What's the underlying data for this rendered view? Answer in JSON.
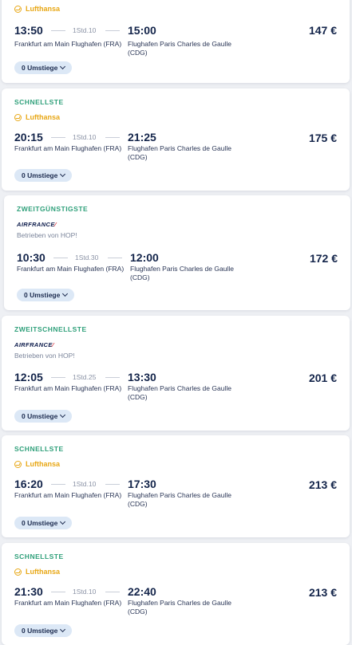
{
  "flights": [
    {
      "badge": "",
      "airline": "Lufthansa",
      "airline_logo": "lufthansa-logo",
      "operated_by": "",
      "departure_time": "13:50",
      "duration": "1Std.10",
      "arrival_time": "15:00",
      "departure_airport": "Frankfurt am Main Flughafen (FRA)",
      "arrival_airport": "Flughafen Paris Charles de Gaulle (CDG)",
      "price": "147 €",
      "stops_label": "0 Umstiege"
    },
    {
      "badge": "SCHNELLSTE",
      "airline": "Lufthansa",
      "airline_logo": "lufthansa-logo",
      "operated_by": "",
      "departure_time": "20:15",
      "duration": "1Std.10",
      "arrival_time": "21:25",
      "departure_airport": "Frankfurt am Main Flughafen (FRA)",
      "arrival_airport": "Flughafen Paris Charles de Gaulle (CDG)",
      "price": "175 €",
      "stops_label": "0 Umstiege"
    },
    {
      "badge": "ZWEITGÜNSTIGSTE",
      "airline": "AIRFRANCE",
      "airline_logo": "air-france-logo",
      "operated_by": "Betrieben von HOP!",
      "departure_time": "10:30",
      "duration": "1Std.30",
      "arrival_time": "12:00",
      "departure_airport": "Frankfurt am Main Flughafen (FRA)",
      "arrival_airport": "Flughafen Paris Charles de Gaulle (CDG)",
      "price": "172 €",
      "stops_label": "0 Umstiege"
    },
    {
      "badge": "ZWEITSCHNELLSTE",
      "airline": "AIRFRANCE",
      "airline_logo": "air-france-logo",
      "operated_by": "Betrieben von HOP!",
      "departure_time": "12:05",
      "duration": "1Std.25",
      "arrival_time": "13:30",
      "departure_airport": "Frankfurt am Main Flughafen (FRA)",
      "arrival_airport": "Flughafen Paris Charles de Gaulle (CDG)",
      "price": "201 €",
      "stops_label": "0 Umstiege"
    },
    {
      "badge": "SCHNELLSTE",
      "airline": "Lufthansa",
      "airline_logo": "lufthansa-logo",
      "operated_by": "",
      "departure_time": "16:20",
      "duration": "1Std.10",
      "arrival_time": "17:30",
      "departure_airport": "Frankfurt am Main Flughafen (FRA)",
      "arrival_airport": "Flughafen Paris Charles de Gaulle (CDG)",
      "price": "213 €",
      "stops_label": "0 Umstiege"
    },
    {
      "badge": "SCHNELLSTE",
      "airline": "Lufthansa",
      "airline_logo": "lufthansa-logo",
      "operated_by": "",
      "departure_time": "21:30",
      "duration": "1Std.10",
      "arrival_time": "22:40",
      "departure_airport": "Frankfurt am Main Flughafen (FRA)",
      "arrival_airport": "Flughafen Paris Charles de Gaulle (CDG)",
      "price": "213 €",
      "stops_label": "0 Umstiege"
    }
  ],
  "colors": {
    "badge": "#2fa07a",
    "lufthansa": "#e8a817",
    "air_france": "#0b1a4a",
    "text_primary": "#13244a",
    "stops_pill": "#dce8f6"
  }
}
